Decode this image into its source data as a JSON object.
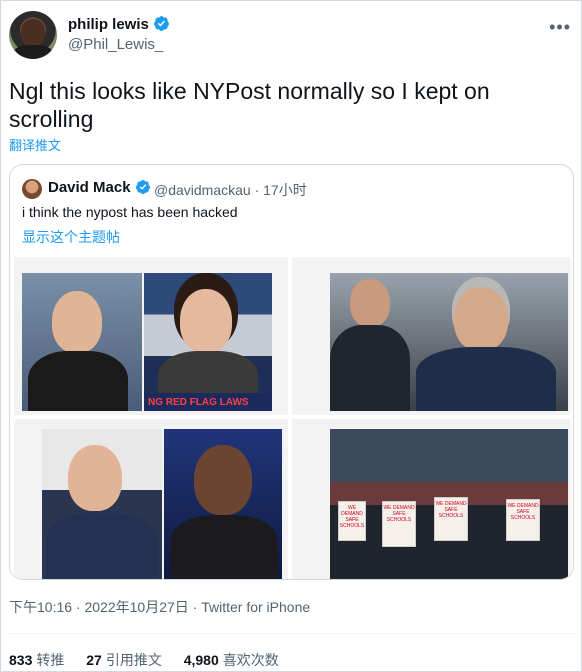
{
  "author": {
    "name": "philip lewis",
    "handle": "@Phil_Lewis_"
  },
  "tweet": {
    "text": "Ngl this looks like NYPost normally so I kept on scrolling",
    "translate_label": "翻译推文"
  },
  "quoted": {
    "name": "David Mack",
    "meta": "@davidmackau · 17小时",
    "text": "i think the nypost has been hacked",
    "thread_label": "显示这个主题帖",
    "banner_text": "NG RED FLAG LAWS",
    "sign_text": "WE DEMAND SAFE SCHOOLS"
  },
  "footer": {
    "timestamp": "下午10:16 · 2022年10月27日 · Twitter for iPhone",
    "retweets_count": "833",
    "retweets_label": "转推",
    "quotes_count": "27",
    "quotes_label": "引用推文",
    "likes_count": "4,980",
    "likes_label": "喜欢次数"
  },
  "colors": {
    "accent": "#1d9bf0",
    "secondary_text": "#536471",
    "border": "#cfd9de"
  },
  "icons": [
    "verified-badge-icon",
    "more-options-icon"
  ]
}
